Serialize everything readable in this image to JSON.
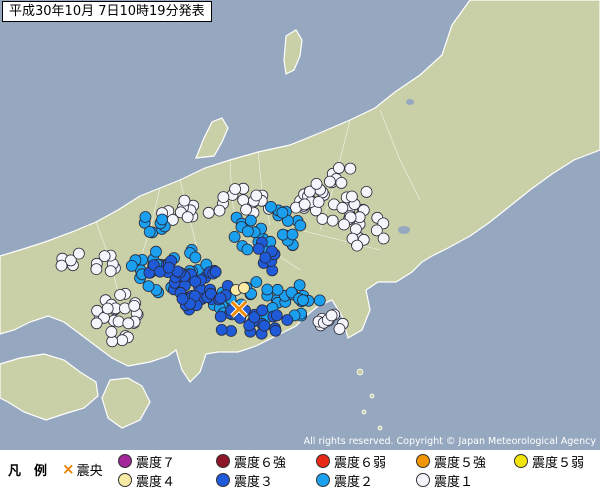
{
  "title": "平成30年10月 7日10時19分発表",
  "copyright": "All rights reserved. Copyright © Japan Meteorological Agency",
  "colors": {
    "sea": "#96a8bf",
    "land": "#c9cfa6",
    "land_border": "#ffffff",
    "int7": "#a3269b",
    "int6u": "#8d1728",
    "int6l": "#e62a16",
    "int5u": "#f19600",
    "int5l": "#f3e50c",
    "int4": "#f9e9a3",
    "int3": "#1f5ad9",
    "int2": "#1aa0ef",
    "int1": "#f4f6fb",
    "epicenter": "#f08c00"
  },
  "legend": {
    "label_legend": "凡　例",
    "epicenter": "震央",
    "items": [
      {
        "key": "int7",
        "label": "震度７"
      },
      {
        "key": "int6u",
        "label": "震度６強"
      },
      {
        "key": "int6l",
        "label": "震度６弱"
      },
      {
        "key": "int5u",
        "label": "震度５強"
      },
      {
        "key": "int5l",
        "label": "震度５弱"
      },
      {
        "key": "int4",
        "label": "震度４"
      },
      {
        "key": "int3",
        "label": "震度３"
      },
      {
        "key": "int2",
        "label": "震度２"
      },
      {
        "key": "int1",
        "label": "震度１"
      }
    ]
  }
}
